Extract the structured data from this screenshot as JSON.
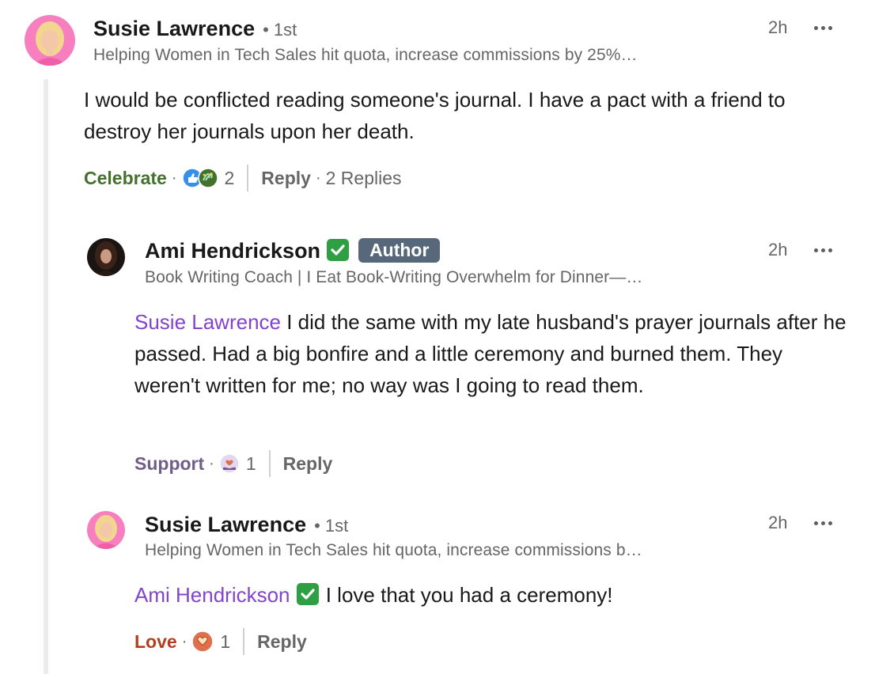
{
  "comment": {
    "author": "Susie Lawrence",
    "degree": "• 1st",
    "headline": "Helping Women in Tech Sales hit quota, increase commissions by 25%…",
    "time": "2h",
    "text": "I would be conflicted reading someone's journal. I have a pact with a friend to destroy her journals upon her death.",
    "reaction_label": "Celebrate",
    "reaction_count": "2",
    "reply_label": "Reply",
    "replies_label": "2 Replies"
  },
  "reply1": {
    "author": "Ami Hendrickson",
    "badge": "Author",
    "headline": "Book Writing Coach | I Eat Book-Writing Overwhelm for Dinner—…",
    "time": "2h",
    "mention": "Susie Lawrence",
    "text": " I did the same with my late husband's prayer journals after he passed. Had a big bonfire and a little ceremony and burned them. They weren't written for me; no way was I going to read them.",
    "reaction_label": "Support",
    "reaction_count": "1",
    "reply_label": "Reply"
  },
  "reply2": {
    "author": "Susie Lawrence",
    "degree": "• 1st",
    "headline": "Helping Women in Tech Sales hit quota, increase commissions b…",
    "time": "2h",
    "mention": "Ami Hendrickson",
    "text": " I love that you had a ceremony!",
    "reaction_label": "Love",
    "reaction_count": "1",
    "reply_label": "Reply"
  },
  "colors": {
    "celebrate": "#44712e",
    "support": "#715e86",
    "love": "#b24020",
    "mention": "#8344cc",
    "author_badge": "#56687a",
    "verified": "#2ea043"
  },
  "icons": [
    "avatar-susie",
    "avatar-ami",
    "verified-check-icon",
    "more-options-icon",
    "celebrate-reaction-icon",
    "like-reaction-icon",
    "support-reaction-icon",
    "love-reaction-icon"
  ]
}
